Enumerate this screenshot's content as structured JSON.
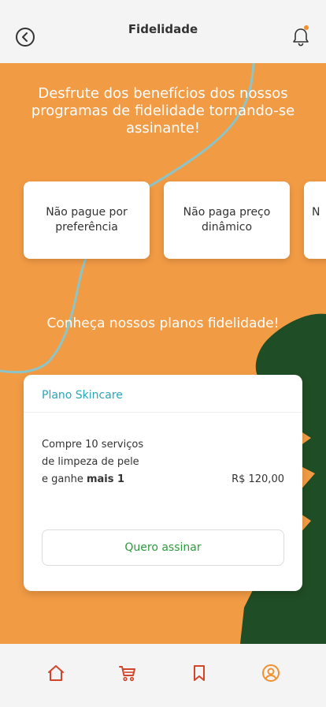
{
  "header": {
    "title": "Fidelidade",
    "back_icon": "chevron-left-circle-icon",
    "bell_icon": "bell-icon",
    "notification_dot_color": "#f0912f"
  },
  "hero": {
    "text": "Desfrute dos benefícios dos nossos programas de fidelidade tornando-se assinante!"
  },
  "benefits": [
    {
      "label": "Não pague por preferência"
    },
    {
      "label": "Não paga preço dinâmico"
    },
    {
      "label": "N"
    }
  ],
  "plans_section": {
    "title": "Conheça nossos planos fidelidade!"
  },
  "plan": {
    "name": "Plano Skincare",
    "description_main": "Compre 10 serviços de limpeza de pele e ganhe ",
    "description_bold": "mais 1",
    "price": "R$ 120,00",
    "button_label": "Quero assinar"
  },
  "bottom_nav": [
    {
      "name": "home",
      "icon": "home-icon",
      "color": "#d2452b"
    },
    {
      "name": "cart",
      "icon": "cart-icon",
      "color": "#d2452b"
    },
    {
      "name": "bookmark",
      "icon": "bookmark-icon",
      "color": "#d2452b"
    },
    {
      "name": "profile",
      "icon": "user-circle-icon",
      "color": "#f0912f"
    }
  ],
  "colors": {
    "background": "#f29b45",
    "accent_teal": "#2aa5b8",
    "accent_green": "#2d9a3d",
    "leaf": "#1f4d25"
  }
}
